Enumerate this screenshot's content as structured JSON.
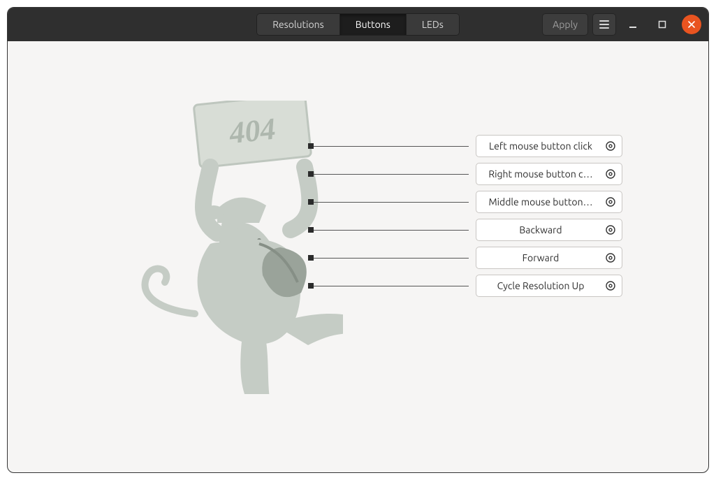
{
  "header": {
    "tabs": [
      {
        "label": "Resolutions",
        "active": false
      },
      {
        "label": "Buttons",
        "active": true
      },
      {
        "label": "LEDs",
        "active": false
      }
    ],
    "apply_label": "Apply"
  },
  "illustration": {
    "sign_text": "404"
  },
  "mappings": [
    {
      "label": "Left mouse button click"
    },
    {
      "label": "Right mouse button c…"
    },
    {
      "label": "Middle mouse button…"
    },
    {
      "label": "Backward"
    },
    {
      "label": "Forward"
    },
    {
      "label": "Cycle Resolution Up"
    }
  ]
}
